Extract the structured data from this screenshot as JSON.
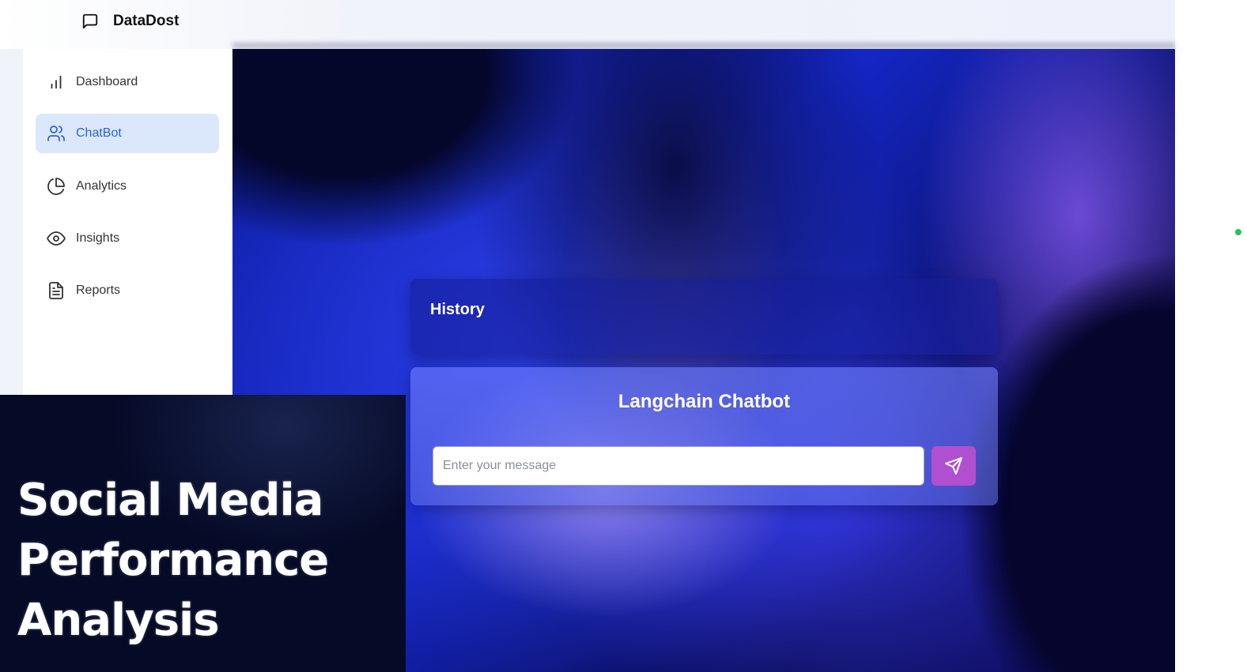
{
  "header": {
    "brand_name": "DataDost",
    "brand_icon": "message-square-icon"
  },
  "sidebar": {
    "items": [
      {
        "label": "Dashboard",
        "icon": "bar-chart-icon",
        "active": false
      },
      {
        "label": "ChatBot",
        "icon": "users-icon",
        "active": true
      },
      {
        "label": "Analytics",
        "icon": "pie-chart-icon",
        "active": false
      },
      {
        "label": "Insights",
        "icon": "eye-icon",
        "active": false
      },
      {
        "label": "Reports",
        "icon": "file-text-icon",
        "active": false
      }
    ]
  },
  "banner": {
    "title": "Social Media\nPerformance\nAnalysis"
  },
  "history": {
    "title": "History"
  },
  "chat": {
    "title": "Langchain Chatbot",
    "input_placeholder": "Enter your message",
    "input_value": "",
    "send_icon": "send-icon"
  },
  "colors": {
    "accent": "#2b63d6",
    "active_item_bg": "#dbe8fc",
    "send_button": "#b04fcf",
    "status_dot": "#22c55e"
  }
}
